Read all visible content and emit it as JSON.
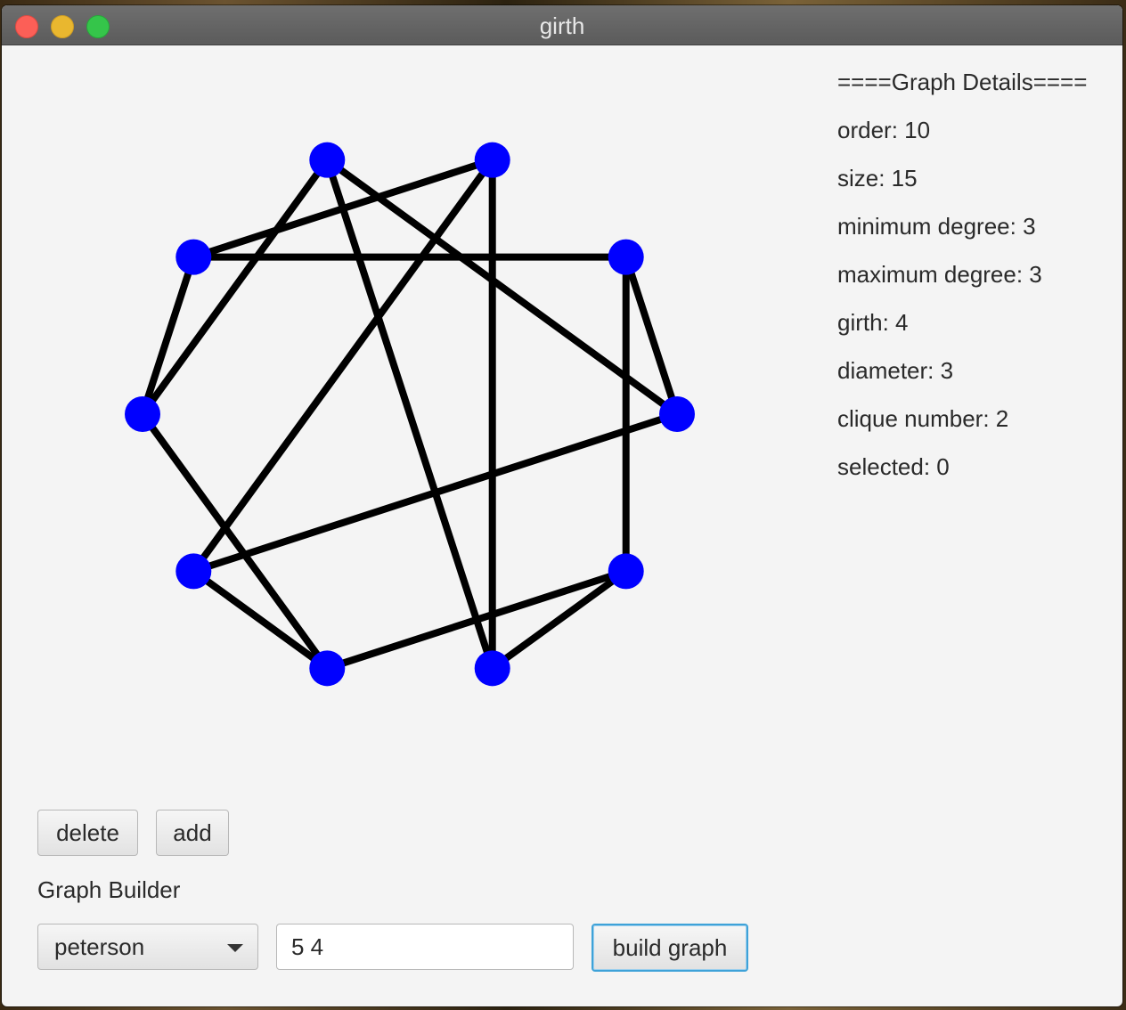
{
  "window": {
    "title": "girth"
  },
  "graph": {
    "vertex_color": "#0000ff",
    "edge_color": "#000000",
    "vertices": [
      "v0",
      "v1",
      "v2",
      "v3",
      "v4",
      "v5",
      "v6",
      "v7",
      "v8",
      "v9"
    ],
    "edges": [
      [
        "v0",
        "v1"
      ],
      [
        "v1",
        "v2"
      ],
      [
        "v2",
        "v3"
      ],
      [
        "v3",
        "v4"
      ],
      [
        "v4",
        "v0"
      ],
      [
        "v0",
        "v5"
      ],
      [
        "v1",
        "v6"
      ],
      [
        "v2",
        "v7"
      ],
      [
        "v3",
        "v8"
      ],
      [
        "v4",
        "v9"
      ],
      [
        "v5",
        "v7"
      ],
      [
        "v7",
        "v9"
      ],
      [
        "v9",
        "v6"
      ],
      [
        "v6",
        "v8"
      ],
      [
        "v8",
        "v5"
      ]
    ]
  },
  "details": {
    "header": "====Graph Details====",
    "order": "order: 10",
    "size": "size: 15",
    "min_degree": "minimum degree: 3",
    "max_degree": "maximum degree: 3",
    "girth": "girth: 4",
    "diameter": "diameter: 3",
    "clique_number": "clique number: 2",
    "selected": "selected: 0"
  },
  "buttons": {
    "delete": "delete",
    "add": "add",
    "build": "build graph"
  },
  "builder": {
    "label": "Graph Builder",
    "graph_type": "peterson",
    "params_value": "5 4"
  }
}
